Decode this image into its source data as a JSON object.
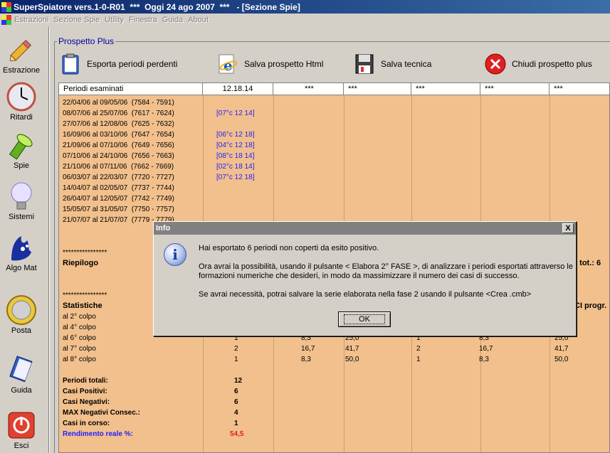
{
  "window": {
    "title": "SuperSpiatore vers.1-0-R01  ***  Oggi 24 ago 2007  ***   - [Sezione Spie]"
  },
  "menu": [
    "Estrazioni",
    "Sezione Spie",
    "Utility",
    "Finestra",
    "Guida",
    "About"
  ],
  "sidebar": [
    {
      "label": "Estrazione",
      "icon": "pencil-icon"
    },
    {
      "label": "Ritardi",
      "icon": "clock-icon"
    },
    {
      "label": "Spie",
      "icon": "flashlight-icon"
    },
    {
      "label": "Sistemi",
      "icon": "lightbulb-icon"
    },
    {
      "label": "Algo Mat",
      "icon": "lottery-hand-icon"
    },
    {
      "label": "Posta",
      "icon": "coin-icon"
    },
    {
      "label": "Guida",
      "icon": "book-icon"
    },
    {
      "label": "Esci",
      "icon": "power-icon"
    }
  ],
  "panel": {
    "title": "Prospetto Plus",
    "toolbar": [
      {
        "label": "Esporta periodi perdenti",
        "icon": "clipboard-icon"
      },
      {
        "label": "Salva prospetto Html",
        "icon": "ie-icon"
      },
      {
        "label": "Salva tecnica",
        "icon": "floppy-icon"
      },
      {
        "label": "Chiudi prospetto plus",
        "icon": "close-red-icon"
      }
    ]
  },
  "grid": {
    "headers": [
      "Periodi esaminati",
      "12.18.14",
      "***",
      "***",
      "***",
      "***",
      "***"
    ],
    "periods": [
      {
        "text": "22/04/06 al 09/05/06  (7584 - 7591)",
        "hit": ""
      },
      {
        "text": "08/07/06 al 25/07/06  (7617 - 7624)",
        "hit": "[07°c 12 14]"
      },
      {
        "text": "27/07/06 al 12/08/06  (7625 - 7632)",
        "hit": ""
      },
      {
        "text": "16/09/06 al 03/10/06  (7647 - 7654)",
        "hit": "[06°c 12 18]"
      },
      {
        "text": "21/09/06 al 07/10/06  (7649 - 7656)",
        "hit": "[04°c 12 18]"
      },
      {
        "text": "07/10/06 al 24/10/06  (7656 - 7663)",
        "hit": "[08°c 18 14]"
      },
      {
        "text": "21/10/06 al 07/11/06  (7662 - 7669)",
        "hit": "[02°c 18 14]"
      },
      {
        "text": "06/03/07 al 22/03/07  (7720 - 7727)",
        "hit": "[07°c 12 18]"
      },
      {
        "text": "14/04/07 al 02/05/07  (7737 - 7744)",
        "hit": ""
      },
      {
        "text": "26/04/07 al 12/05/07  (7742 - 7749)",
        "hit": ""
      },
      {
        "text": "15/05/07 al 31/05/07  (7750 - 7757)",
        "hit": ""
      },
      {
        "text": "21/07/07 al 21/07/07  (7779 - 7779)",
        "hit": ""
      }
    ],
    "stars1": "****************",
    "riepilogo": "Riepilogo",
    "riepilogo_right": "e tot.: 6",
    "stars2": "****************",
    "statistiche": "Statistiche",
    "statistiche_right": "CI progr.",
    "colpi": [
      {
        "label": "al 2° colpo",
        "v1": "",
        "v2": "",
        "v3": "",
        "v4": "",
        "v5": "",
        "v6": ""
      },
      {
        "label": "al 4° colpo",
        "v1": "",
        "v2": "",
        "v3": "",
        "v4": "",
        "v5": "",
        "v6": ""
      },
      {
        "label": "al 6° colpo",
        "v1": "1",
        "v2": "8,3",
        "v3": "25,0",
        "v4": "1",
        "v5": "8,3",
        "v6": "25,0"
      },
      {
        "label": "al 7° colpo",
        "v1": "2",
        "v2": "16,7",
        "v3": "41,7",
        "v4": "2",
        "v5": "16,7",
        "v6": "41,7"
      },
      {
        "label": "al 8° colpo",
        "v1": "1",
        "v2": "8,3",
        "v3": "50,0",
        "v4": "1",
        "v5": "8,3",
        "v6": "50,0"
      }
    ],
    "totals": [
      {
        "label": "Periodi totali:",
        "value": "12"
      },
      {
        "label": "Casi Positivi:",
        "value": "6"
      },
      {
        "label": "Casi Negativi:",
        "value": "6"
      },
      {
        "label": "MAX Negativi Consec.:",
        "value": "4"
      },
      {
        "label": "Casi in corso:",
        "value": "1"
      }
    ],
    "rendimento_label": "Rendimento reale %:",
    "rendimento_value": "54,5"
  },
  "dialog": {
    "title": "Info",
    "close": "X",
    "line1": "Hai esportato 6 periodi non coperti da esito positivo.",
    "line2": "Ora avrai la possibilità, usando il pulsante < Elabora 2° FASE >, di analizzare i periodi esportati attraverso le",
    "line3": "formazioni numeriche che desideri, in modo da massimizzare il numero dei casi di successo.",
    "line4": "Se avrai necessità, potrai salvare la serie elaborata nella fase 2 usando il pulsante <Crea .cmb>",
    "ok": "OK",
    "info_glyph": "i"
  }
}
